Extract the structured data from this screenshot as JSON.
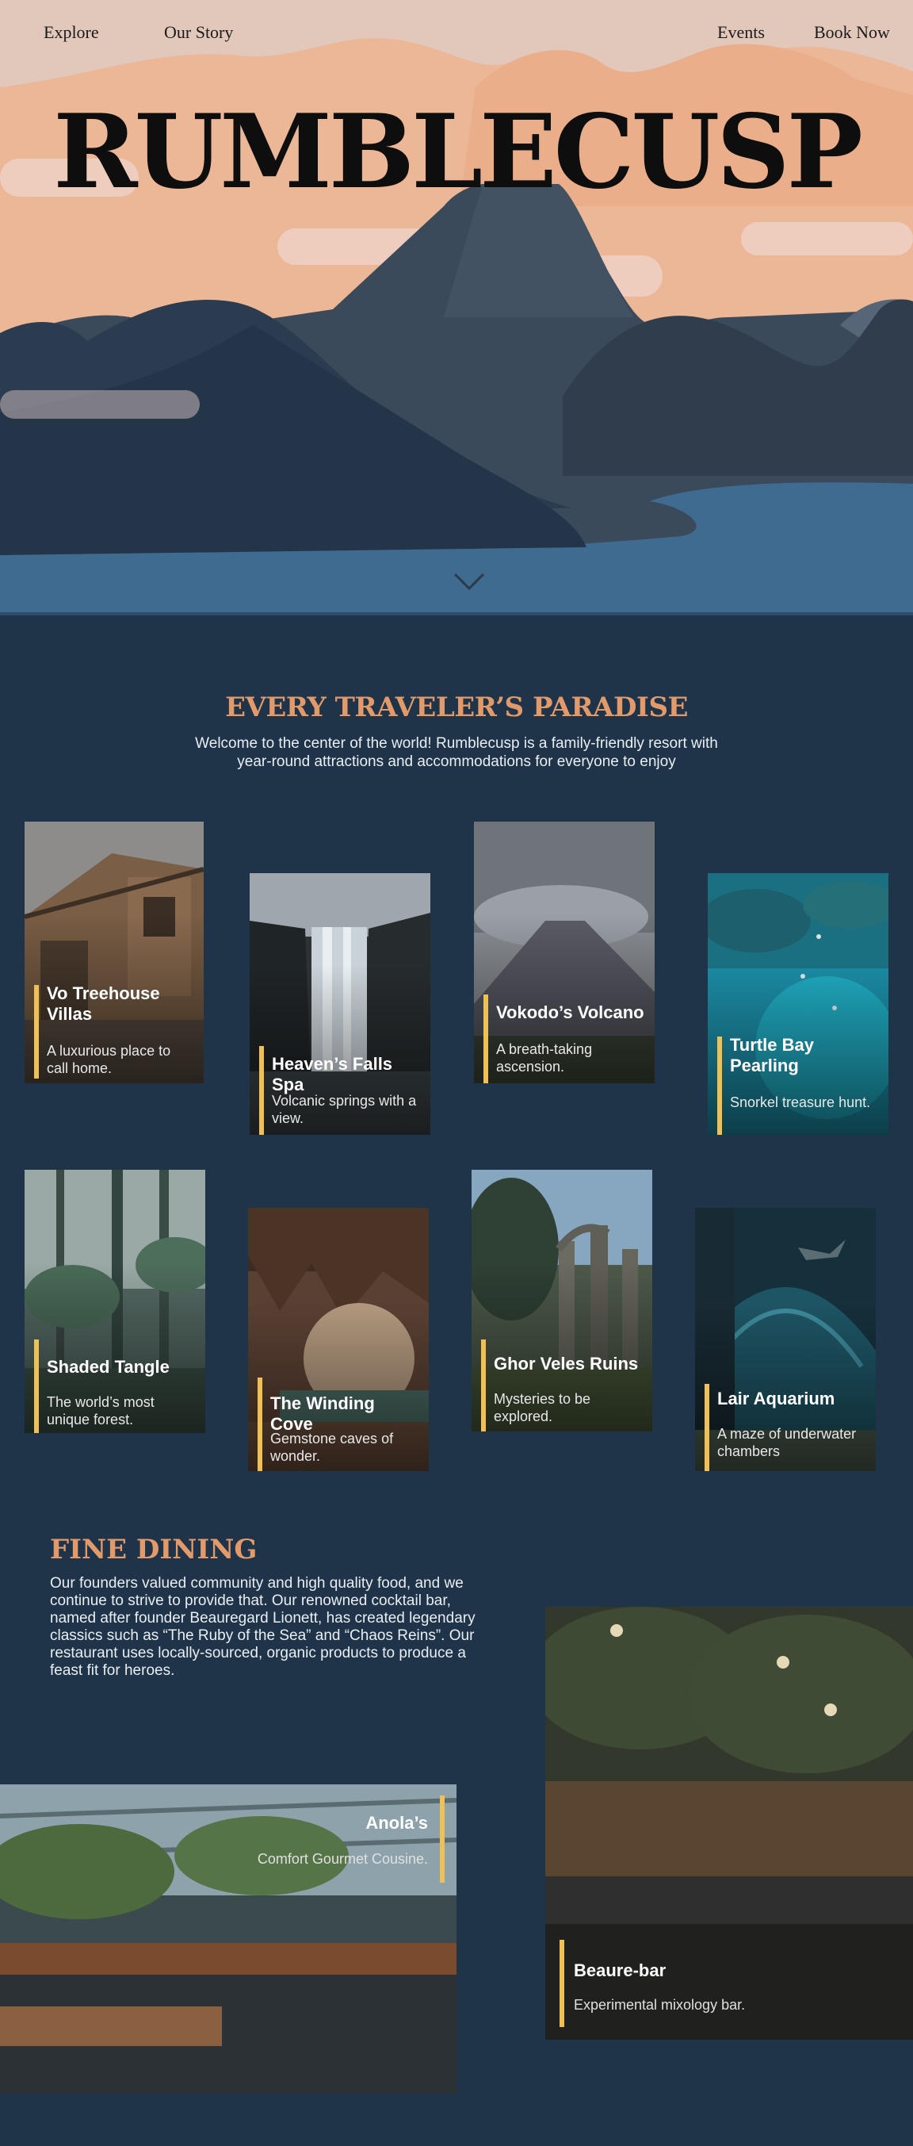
{
  "nav": {
    "left": [
      "Explore",
      "Our Story"
    ],
    "right": [
      "Events",
      "Book Now"
    ]
  },
  "hero": {
    "title": "RUMBLECUSP"
  },
  "paradise": {
    "title": "EVERY TRAVELER’S PARADISE",
    "description": "Welcome to the center of the world! Rumblecusp is a family-friendly resort with year-round attractions and accommodations for everyone to enjoy"
  },
  "attractions": [
    {
      "title": "Vo Treehouse Villas",
      "description": "A luxurious place to call home."
    },
    {
      "title": "Heaven’s Falls Spa",
      "description": "Volcanic springs with a view."
    },
    {
      "title": "Vokodo’s Volcano",
      "description": "A breath-taking ascension."
    },
    {
      "title": "Turtle Bay Pearling",
      "description": "Snorkel treasure hunt."
    },
    {
      "title": "Shaded Tangle",
      "description": "The world’s most unique forest."
    },
    {
      "title": "The Winding Cove",
      "description": "Gemstone caves of wonder."
    },
    {
      "title": "Ghor Veles Ruins",
      "description": "Mysteries to be explored."
    },
    {
      "title": "Lair Aquarium",
      "description": "A maze of underwater chambers"
    }
  ],
  "dining": {
    "title": "FINE DINING",
    "description": "Our founders valued community and high quality food, and we continue to strive to provide that. Our renowned cocktail bar, named after founder Beauregard Lionett, has created legendary classics such as “The Ruby of the Sea” and “Chaos Reins”. Our restaurant uses locally-sourced, organic products to produce a feast fit for heroes.",
    "venues": [
      {
        "title": "Beaure-bar",
        "description": "Experimental mixology bar."
      },
      {
        "title": "Anola’s",
        "description": "Comfort Gourmet Cousine."
      }
    ]
  },
  "colors": {
    "background": "#1f3449",
    "accent": "#e39a6b",
    "highlight_bar": "#f0c054"
  },
  "icons": {
    "scroll": "chevron-down-icon"
  }
}
